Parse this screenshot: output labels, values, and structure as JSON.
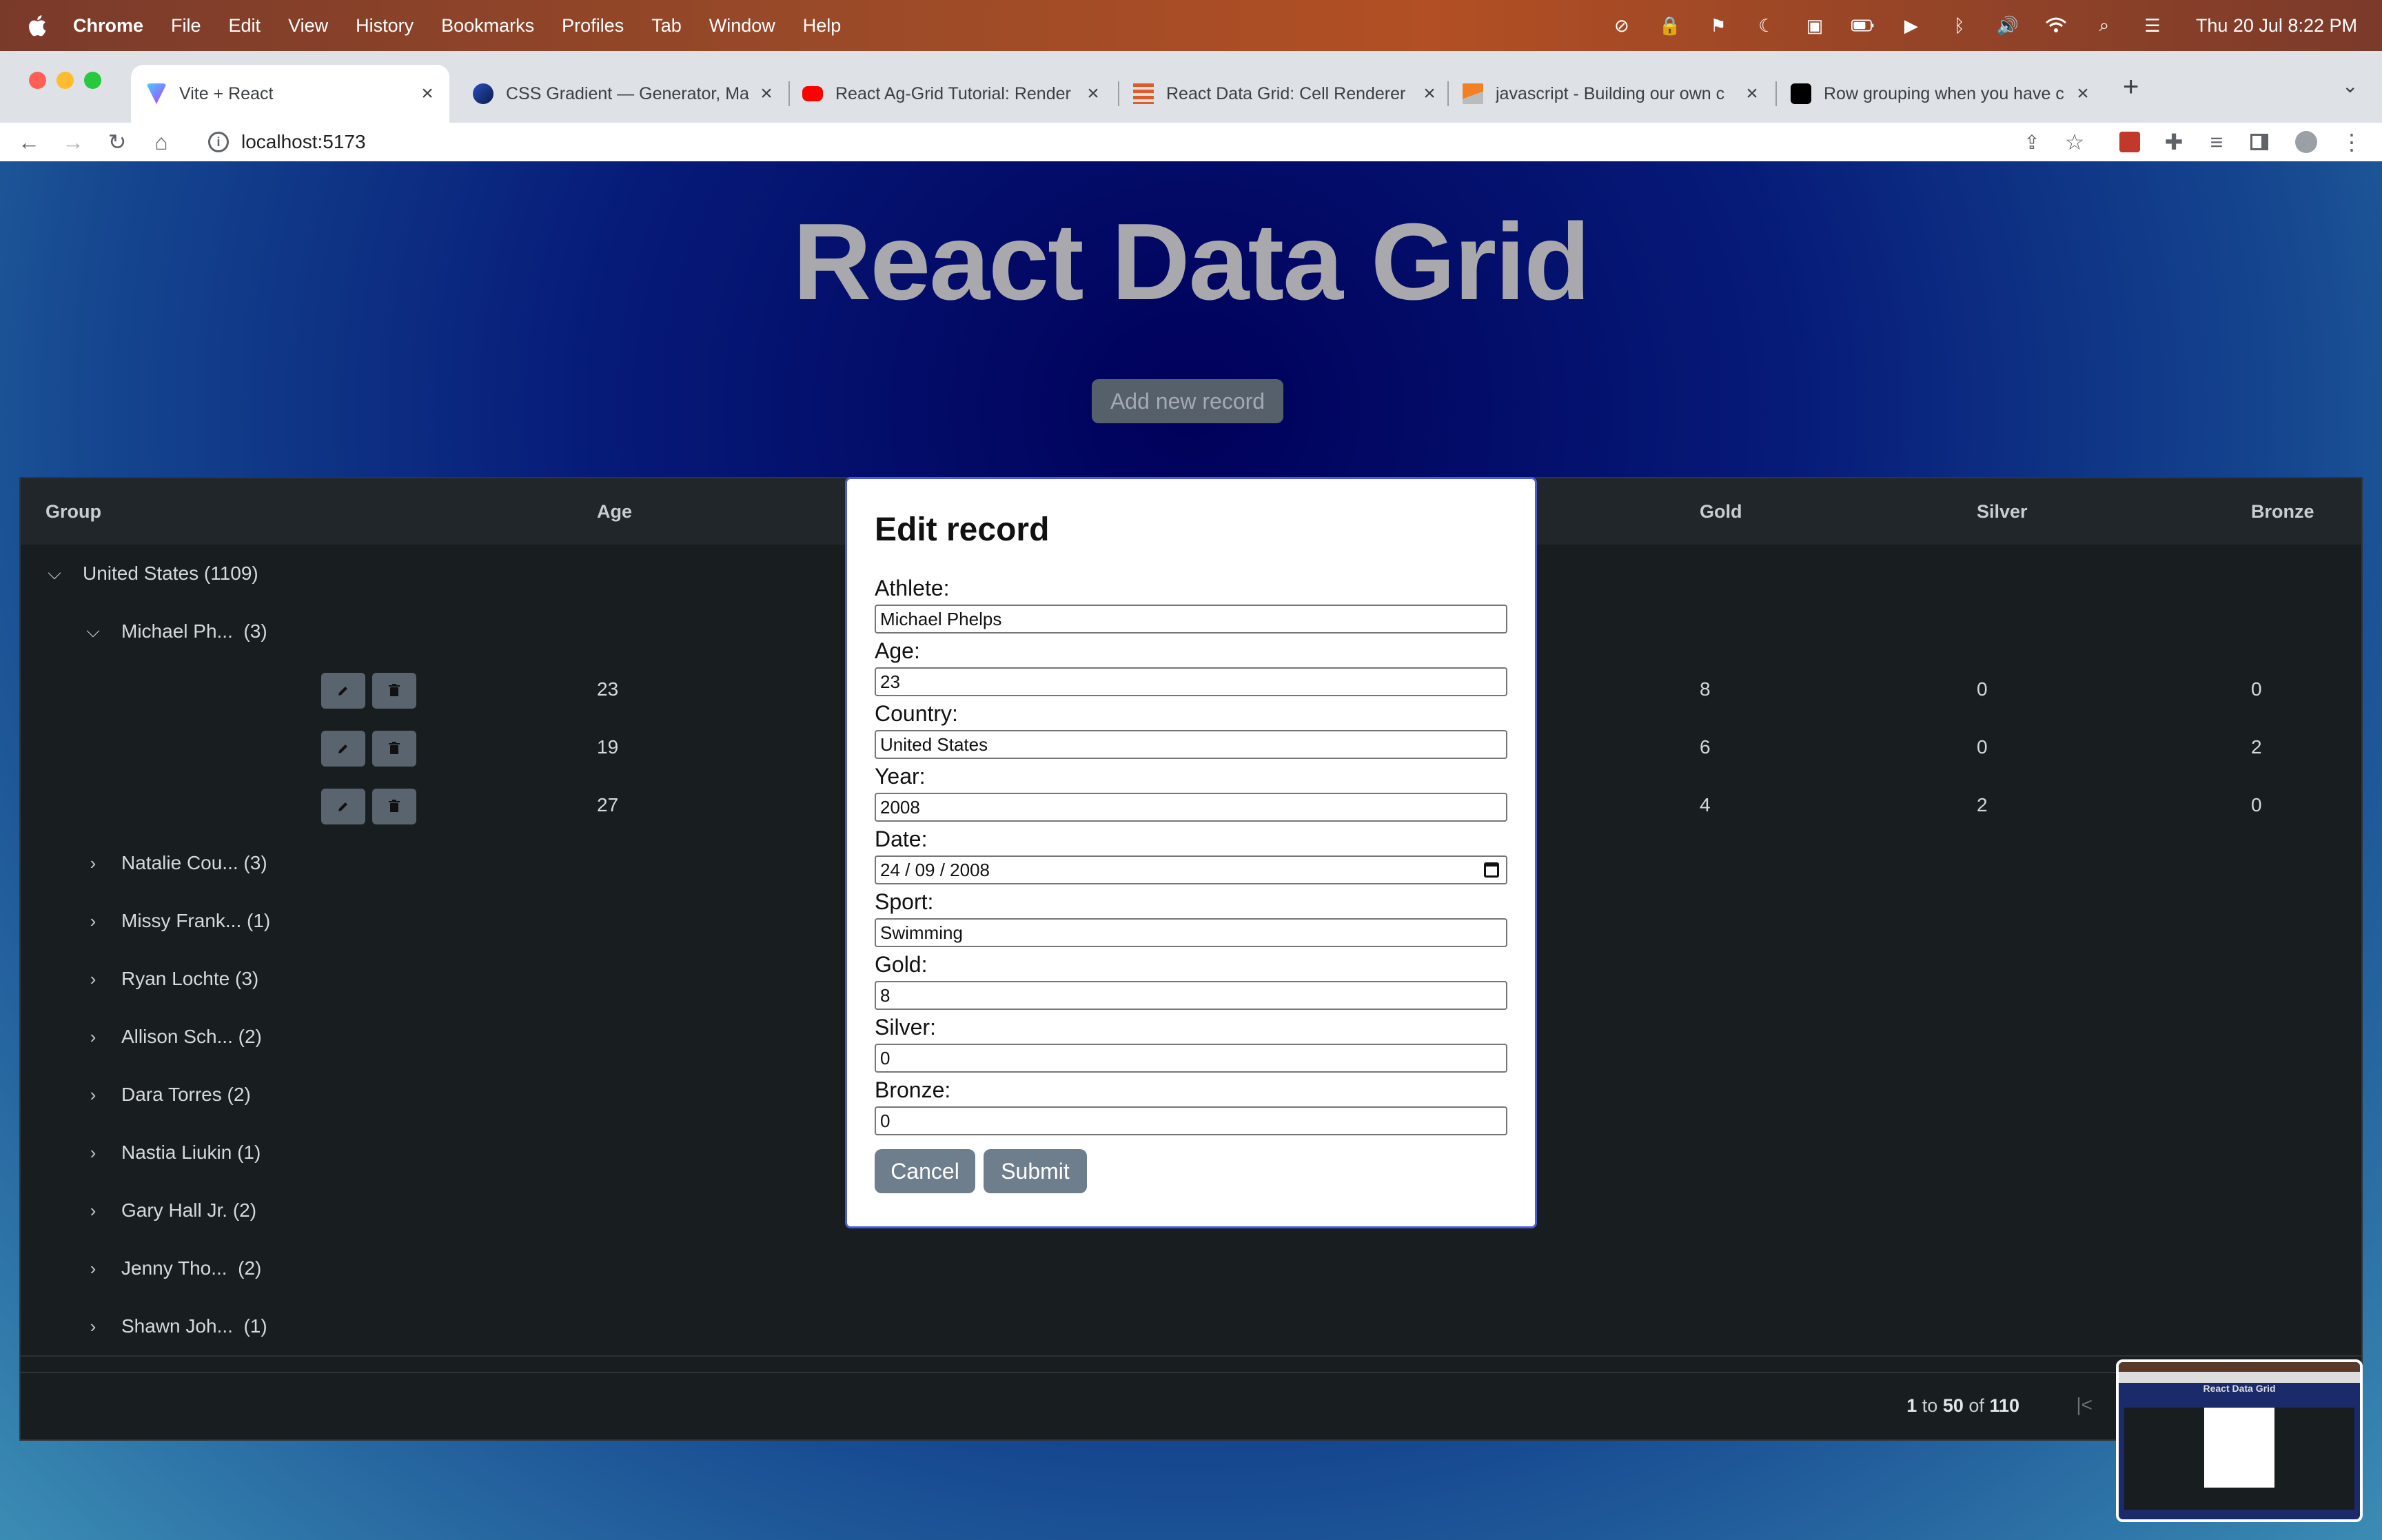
{
  "menubar": {
    "app": "Chrome",
    "items": [
      "File",
      "Edit",
      "View",
      "History",
      "Bookmarks",
      "Profiles",
      "Tab",
      "Window",
      "Help"
    ],
    "clock": "Thu 20 Jul  8:22 PM"
  },
  "tabs": [
    {
      "title": "Vite + React",
      "icon": "vite-icon"
    },
    {
      "title": "CSS Gradient — Generator, Ma",
      "icon": "css-gradient-icon"
    },
    {
      "title": "React Ag-Grid Tutorial: Render",
      "icon": "youtube-icon"
    },
    {
      "title": "React Data Grid: Cell Renderer",
      "icon": "ag-grid-icon"
    },
    {
      "title": "javascript - Building our own c",
      "icon": "stackoverflow-icon"
    },
    {
      "title": "Row grouping when you have c",
      "icon": "medium-icon"
    }
  ],
  "address": {
    "url": "localhost:5173"
  },
  "page": {
    "title": "React Data Grid",
    "add_button": "Add new record"
  },
  "grid": {
    "headers": {
      "group": "Group",
      "age": "Age",
      "gold": "Gold",
      "silver": "Silver",
      "bronze": "Bronze"
    },
    "country_row": "United States (1109)",
    "athlete_expanded": "Michael Ph...",
    "athlete_expanded_count": "(3)",
    "detail_rows": [
      {
        "age": "23",
        "gold": "8",
        "silver": "0",
        "bronze": "0"
      },
      {
        "age": "19",
        "gold": "6",
        "silver": "0",
        "bronze": "2"
      },
      {
        "age": "27",
        "gold": "4",
        "silver": "2",
        "bronze": "0"
      }
    ],
    "collapsed_groups": [
      {
        "name": "Natalie Cou...",
        "count": "(3)"
      },
      {
        "name": "Missy Frank...",
        "count": "(1)"
      },
      {
        "name": "Ryan Lochte",
        "count": "(3)"
      },
      {
        "name": "Allison Sch...",
        "count": "(2)"
      },
      {
        "name": "Dara Torres",
        "count": "(2)"
      },
      {
        "name": "Nastia Liukin",
        "count": "(1)"
      },
      {
        "name": "Gary Hall Jr.",
        "count": "(2)"
      },
      {
        "name": "Jenny Tho...",
        "count": "(2)"
      },
      {
        "name": "Shawn Joh...",
        "count": "(1)"
      }
    ],
    "pager": {
      "from": "1",
      "to_word": "to",
      "to": "50",
      "of_word": "of",
      "total": "110"
    }
  },
  "modal": {
    "title": "Edit record",
    "fields": [
      {
        "label": "Athlete:",
        "value": "Michael Phelps"
      },
      {
        "label": "Age:",
        "value": "23"
      },
      {
        "label": "Country:",
        "value": "United States"
      },
      {
        "label": "Year:",
        "value": "2008"
      },
      {
        "label": "Date:",
        "value": "24 / 09 / 2008"
      },
      {
        "label": "Sport:",
        "value": "Swimming"
      },
      {
        "label": "Gold:",
        "value": "8"
      },
      {
        "label": "Silver:",
        "value": "0"
      },
      {
        "label": "Bronze:",
        "value": "0"
      }
    ],
    "cancel": "Cancel",
    "submit": "Submit"
  },
  "thumbnail": {
    "title": "React Data Grid"
  },
  "colors": {
    "accent": "#4a5bd8",
    "button": "#6f7e8c",
    "grid_bg": "#181d1f"
  }
}
